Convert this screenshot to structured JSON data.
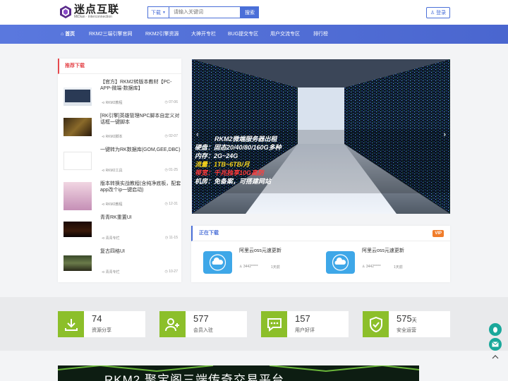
{
  "logo": {
    "name": "迷点互联",
    "sub": "MiDian · interconnection"
  },
  "search": {
    "dropdown": "下载",
    "placeholder": "请输入关键词",
    "button": "搜索"
  },
  "login": "登录",
  "nav": [
    "首页",
    "RKM2三端引擎官网",
    "RKM2引擎资源",
    "大神开专栏",
    "BUG提交专区",
    "用户交流专区",
    "排行榜"
  ],
  "recommend": {
    "title": "推荐下载",
    "items": [
      {
        "title": "【官方】RKM2转版本教材【PC-APP-微端-数据库】",
        "category": "RKM2教程",
        "date": "07-06"
      },
      {
        "title": "[RK引擎]英雄管理NPC脚本自定义对话框一键脚本",
        "category": "RKM2脚本",
        "date": "02-07"
      },
      {
        "title": "一键转为RK数据库(GOM,GEE,DBC)",
        "category": "RKM2工具",
        "date": "01-25"
      },
      {
        "title": "版本转换实战教程(含纯净底板，配套app改个ip一键启动)",
        "category": "RKM2教程",
        "date": "12-31"
      },
      {
        "title": "青青RK重置UI",
        "category": "青青专栏",
        "date": "11-15"
      },
      {
        "title": "复古四格UI",
        "category": "青青专栏",
        "date": "10-27"
      }
    ]
  },
  "banner": {
    "title": "RKM2微端服务器出租",
    "lines": [
      {
        "label": "硬盘：",
        "value": "固态20/40/80/160G多种",
        "color": "#ffffff"
      },
      {
        "label": "内存：",
        "value": "2G~24G",
        "color": "#ffffff"
      },
      {
        "label": "流量：",
        "value": "1TB~6TB/月",
        "color": "#f5d21b"
      },
      {
        "label": "带宽：",
        "value": "千兆独享10G高防",
        "color": "#ff3b3b"
      },
      {
        "label": "机房：",
        "value": "免备案，可搭建网站",
        "color": "#ffffff"
      }
    ]
  },
  "downloading": {
    "title": "正在下载",
    "vip": "VIP",
    "items": [
      {
        "title": "阿里云oss元速更新",
        "user": "3442*****",
        "time": "1天前"
      },
      {
        "title": "阿里云oss元速更新",
        "user": "3442*****",
        "time": "1天前"
      }
    ]
  },
  "stats": [
    {
      "number": "74",
      "unit": "",
      "label": "资源分享",
      "icon": "download-icon"
    },
    {
      "number": "577",
      "unit": "",
      "label": "会员入驻",
      "icon": "add-user-icon"
    },
    {
      "number": "157",
      "unit": "",
      "label": "用户好评",
      "icon": "comment-icon"
    },
    {
      "number": "575",
      "unit": "天",
      "label": "安全运营",
      "icon": "shield-check-icon"
    }
  ],
  "bottom_banner": {
    "text": "RKM2 聚宝阁三端传奇交易平台"
  },
  "colors": {
    "accent": "#4a6fd8",
    "red": "#e5484d",
    "green": "#8cbf2a",
    "teal": "#1aa89b"
  }
}
